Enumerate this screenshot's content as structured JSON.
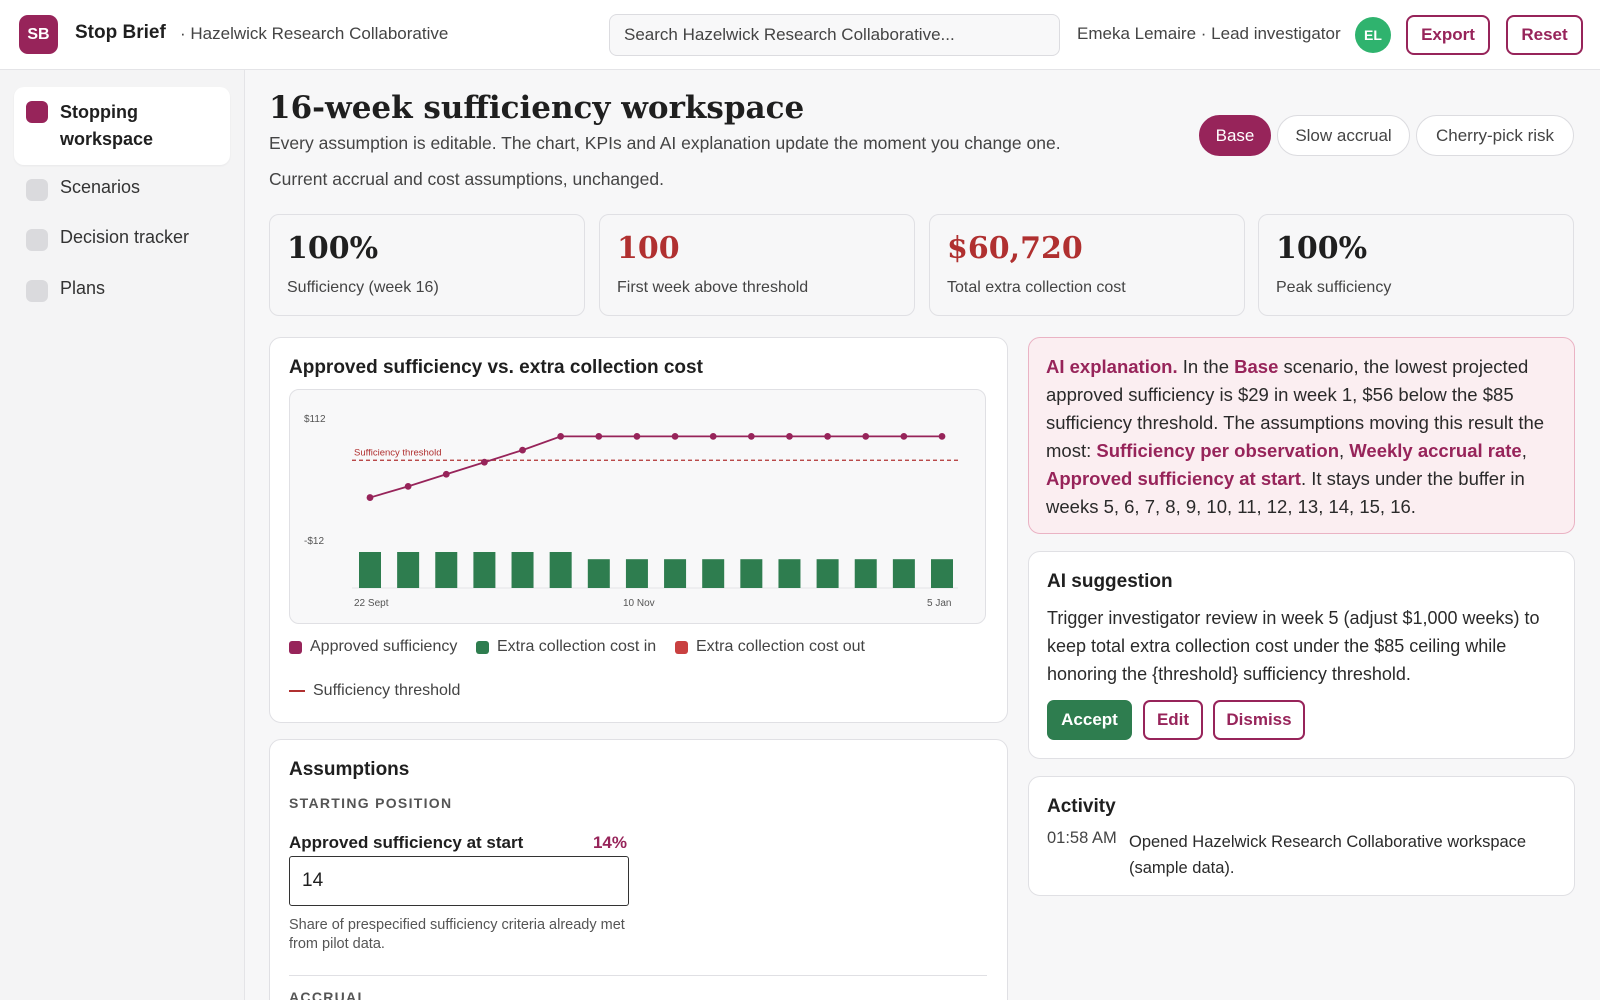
{
  "app": {
    "logo": "SB",
    "name": "Stop Brief",
    "org": "· Hazelwick Research Collaborative"
  },
  "search": {
    "placeholder": "Search Hazelwick Research Collaborative..."
  },
  "user": {
    "label": "Emeka Lemaire · Lead investigator",
    "initials": "EL"
  },
  "toolbar": {
    "export_label": "Export",
    "reset_label": "Reset"
  },
  "sidebar": {
    "items": [
      {
        "label": "Stopping workspace",
        "active": true
      },
      {
        "label": "Scenarios"
      },
      {
        "label": "Decision tracker"
      },
      {
        "label": "Plans"
      }
    ]
  },
  "main": {
    "title": "16-week sufficiency workspace",
    "subtitle": "Every assumption is editable. The chart, KPIs and AI explanation update the moment you change one.",
    "description": "Current accrual and cost assumptions, unchanged.",
    "scenarios": [
      "Base",
      "Slow accrual",
      "Cherry-pick risk"
    ]
  },
  "kpis": [
    {
      "value": "100%",
      "label": "Sufficiency (week 16)"
    },
    {
      "value": "100",
      "label": "First week above threshold"
    },
    {
      "value": "$60,720",
      "label": "Total extra collection cost"
    },
    {
      "value": "100%",
      "label": "Peak sufficiency"
    }
  ],
  "chart_panel": {
    "title": "Approved sufficiency vs. extra collection cost",
    "legend": [
      "Approved sufficiency",
      "Extra collection cost in",
      "Extra collection cost out",
      "Sufficiency threshold"
    ]
  },
  "chart_data": {
    "type": "bar",
    "x_ticks": [
      "22 Sept",
      "10 Nov",
      "5 Jan"
    ],
    "y_ticks": [
      "$112",
      "-$12"
    ],
    "threshold_label": "Sufficiency threshold",
    "threshold": 85,
    "ylim": [
      0,
      112
    ],
    "series": [
      {
        "name": "Approved sufficiency",
        "type": "line",
        "values": [
          29,
          42,
          56,
          70,
          84,
          100,
          100,
          100,
          100,
          100,
          100,
          100,
          100,
          100,
          100,
          100
        ]
      },
      {
        "name": "Extra collection cost in",
        "type": "bar",
        "values": [
          100,
          100,
          100,
          100,
          100,
          100,
          80,
          80,
          80,
          80,
          80,
          80,
          80,
          80,
          80,
          80
        ]
      }
    ],
    "colors": {
      "line": "#97245a",
      "bar": "#2e7d4f",
      "threshold": "#b03030"
    }
  },
  "ai_explanation": {
    "lead": "AI explanation.",
    "t1": " In the ",
    "scenario": "Base",
    "t2": " scenario, the lowest projected approved sufficiency is $29 in week 1, $56 below the $85 sufficiency threshold. The assumptions moving this result the most: ",
    "a1": "Sufficiency per observation",
    "sep1": ", ",
    "a2": "Weekly accrual rate",
    "sep2": ", ",
    "a3": "Approved sufficiency at start",
    "t3": ". It stays under the buffer in weeks 5, 6, 7, 8, 9, 10, 11, 12, 13, 14, 15, 16."
  },
  "ai_suggestion": {
    "title": "AI suggestion",
    "text": "Trigger investigator review in week 5 (adjust $1,000 weeks) to keep total extra collection cost under the $85 ceiling while honoring the {threshold} sufficiency threshold.",
    "accept": "Accept",
    "edit": "Edit",
    "dismiss": "Dismiss"
  },
  "activity": {
    "title": "Activity",
    "entries": [
      {
        "time": "01:58 AM",
        "text": "Opened Hazelwick Research Collaborative workspace (sample data)."
      }
    ]
  },
  "assumptions": {
    "title": "Assumptions",
    "section1": "STARTING POSITION",
    "field_label": "Approved sufficiency at start",
    "field_display": "14%",
    "field_value": "14",
    "field_help": "Share of prespecified sufficiency criteria already met from pilot data.",
    "section2": "ACCRUAL"
  }
}
